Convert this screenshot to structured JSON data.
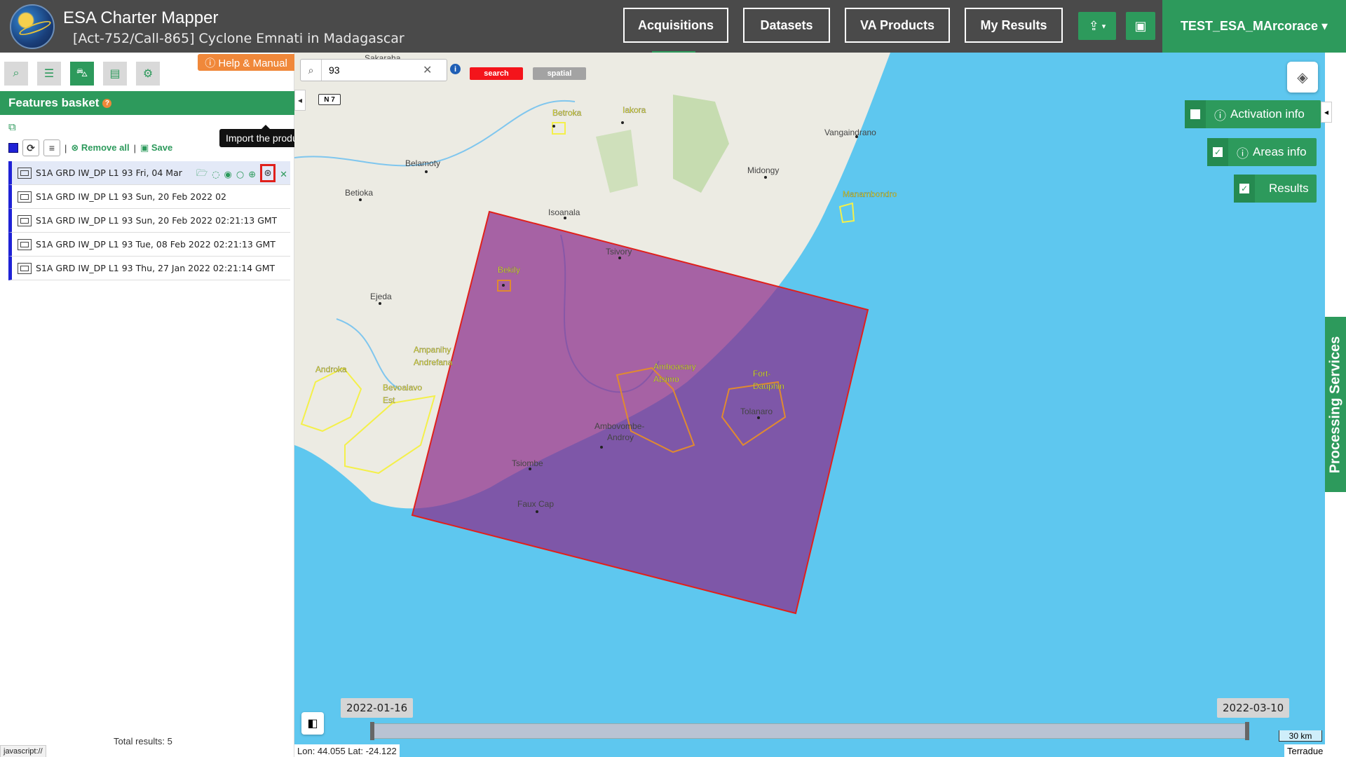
{
  "header": {
    "app_title": "ESA Charter Mapper",
    "activation_title": "[Act-752/Call-865] Cyclone Emnati in Madagascar",
    "nav": [
      "Acquisitions",
      "Datasets",
      "VA Products",
      "My Results"
    ],
    "user": "TEST_ESA_MArcorace ▾"
  },
  "sidebar": {
    "help_label": "ⓘ Help & Manual",
    "panel_title": "Features basket",
    "remove_all": "Remove all",
    "save": "Save",
    "items": [
      "S1A GRD IW_DP L1 93 Fri, 04 Mar",
      "S1A GRD IW_DP L1 93 Sun, 20 Feb 2022 02",
      "S1A GRD IW_DP L1 93 Sun, 20 Feb 2022 02:21:13 GMT",
      "S1A GRD IW_DP L1 93 Tue, 08 Feb 2022 02:21:13 GMT",
      "S1A GRD IW_DP L1 93 Thu, 27 Jan 2022 02:21:14 GMT"
    ],
    "tooltip": "Import the product",
    "total": "Total results: 5"
  },
  "status_bar_url": "javascript://",
  "map": {
    "search_value": "93",
    "pill_search": "search",
    "pill_spatial": "spatial",
    "road_label": "N 7",
    "activation_info": "Activation info",
    "areas_info": "Areas info",
    "results": "Results",
    "processing_services": "Processing Services",
    "date_start": "2022-01-16",
    "date_end": "2022-03-10",
    "coords": "Lon: 44.055 Lat: -24.122",
    "scale": "30 km",
    "attribution": "Terradue",
    "places": [
      "Sakaraha",
      "Iakora",
      "Betroka",
      "Vangaindrano",
      "Belamoty",
      "Midongy",
      "Betioka",
      "Manambondro",
      "Isoanala",
      "Tsivory",
      "Bekily",
      "Ejeda",
      "Ampanihy",
      "Andrefana",
      "Androka",
      "Amboasary",
      "Atsimo",
      "Fort-",
      "Dauphin",
      "Bevoalavo",
      "Est",
      "Ambovombe-",
      "Androy",
      "Tolanaro",
      "Tsiombe",
      "Faux Cap"
    ],
    "colors": {
      "accent": "#2d9a5c",
      "sea": "#5ec7ef",
      "footprint": "#a0307e",
      "help": "#f0883a",
      "highlight": "#e0201b"
    }
  }
}
